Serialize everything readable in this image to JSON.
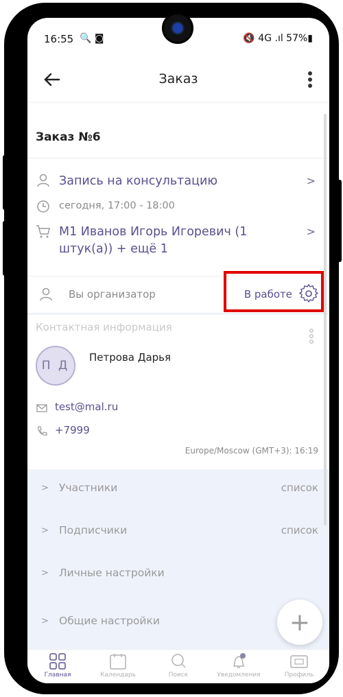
{
  "status_bar": {
    "time": "16:55",
    "left_icons": "🔍 ◙",
    "right_icons": "🔇 4G .ıl 57%▮"
  },
  "app_bar": {
    "title": "Заказ",
    "back_icon": "arrow-left-icon",
    "menu_icon": "more-vert-icon"
  },
  "order": {
    "title": "Заказ №6",
    "service": "Запись на консультацию",
    "time": "сегодня, 17:00 - 18:00",
    "items": "М1 Иванов Игорь Игоревич (1 штук(а)) + ещё 1",
    "organizer_label": "Вы организатор",
    "status": "В работе"
  },
  "contact": {
    "heading": "Контактная информация",
    "initials": "П Д",
    "name": "Петрова Дарья",
    "email": "test@mal.ru",
    "phone": "+7999",
    "timezone": "Europe/Moscow (GMT+3): 16:19"
  },
  "sections": [
    {
      "title": "Участники",
      "tag": "список"
    },
    {
      "title": "Подписчики",
      "tag": "список"
    },
    {
      "title": "Личные настройки",
      "tag": ""
    },
    {
      "title": "Общие настройки",
      "tag": ""
    }
  ],
  "fab_label": "+",
  "bottom_nav": [
    {
      "label": "Главная",
      "icon": "grid-icon",
      "active": true
    },
    {
      "label": "Календарь",
      "icon": "calendar-icon",
      "active": false
    },
    {
      "label": "Поиск",
      "icon": "search-icon",
      "active": false
    },
    {
      "label": "Уведомления",
      "icon": "bell-icon",
      "active": false
    },
    {
      "label": "Профиль",
      "icon": "profile-card-icon",
      "active": false
    }
  ],
  "colors": {
    "accent": "#5a4f8f",
    "highlight": "#e00000",
    "section_bg": "#eef2fb"
  }
}
